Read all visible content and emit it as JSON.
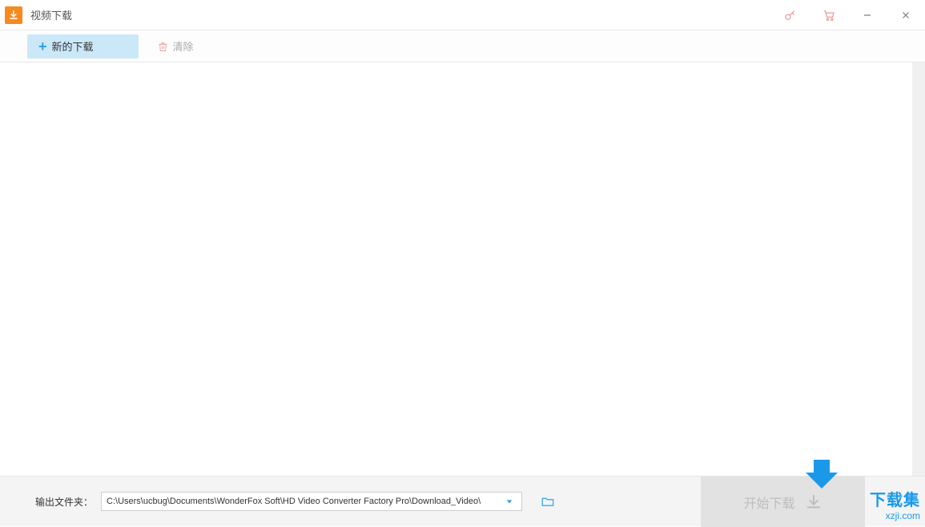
{
  "window": {
    "title": "视频下载"
  },
  "toolbar": {
    "new_download_label": "新的下载",
    "clear_label": "清除"
  },
  "footer": {
    "output_label": "输出文件夹：",
    "output_path": "C:\\Users\\ucbug\\Documents\\WonderFox Soft\\HD Video Converter Factory Pro\\Download_Video\\",
    "start_label": "开始下载"
  },
  "watermark": {
    "line1": "下载集",
    "line2": "xzji.com"
  }
}
